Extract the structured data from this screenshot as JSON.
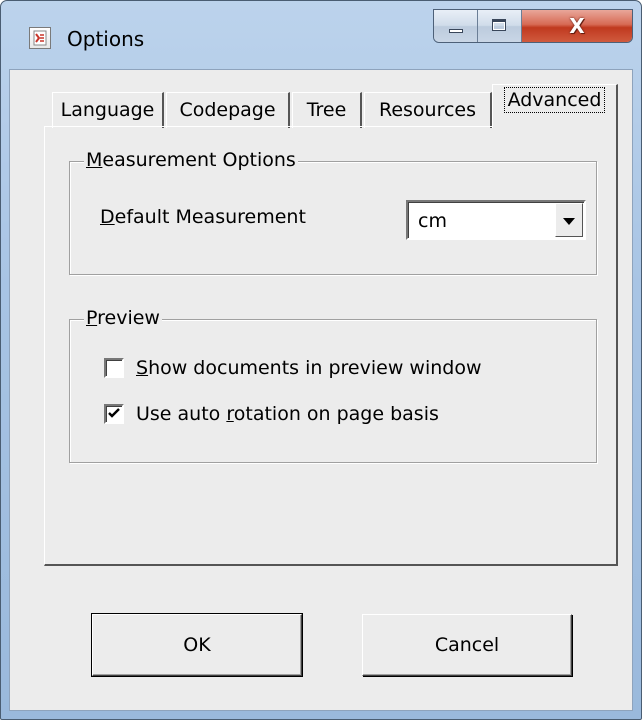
{
  "window": {
    "title": "Options",
    "accent_color": "#c0391f",
    "controls": {
      "minimize_icon": "minimize-icon",
      "maximize_icon": "maximize-icon",
      "close_icon": "close-icon",
      "close_glyph": "X"
    }
  },
  "tabs": [
    {
      "label": "Language",
      "active": false
    },
    {
      "label": "Codepage",
      "active": false
    },
    {
      "label": "Tree",
      "active": false
    },
    {
      "label": "Resources",
      "active": false
    },
    {
      "label": "Advanced",
      "active": true
    }
  ],
  "measurement": {
    "group_label_first": "M",
    "group_label_rest": "easurement Options",
    "field_label_first": "D",
    "field_label_rest": "efault Measurement",
    "selected_value": "cm"
  },
  "preview": {
    "group_label_first": "P",
    "group_label_rest": "review",
    "show_docs": {
      "label_first": "S",
      "label_rest": "how documents in preview window",
      "checked": false
    },
    "auto_rotation": {
      "label_pre": "Use auto ",
      "label_ul": "r",
      "label_post": "otation on page basis",
      "checked": true
    }
  },
  "buttons": {
    "ok": "OK",
    "cancel": "Cancel"
  }
}
